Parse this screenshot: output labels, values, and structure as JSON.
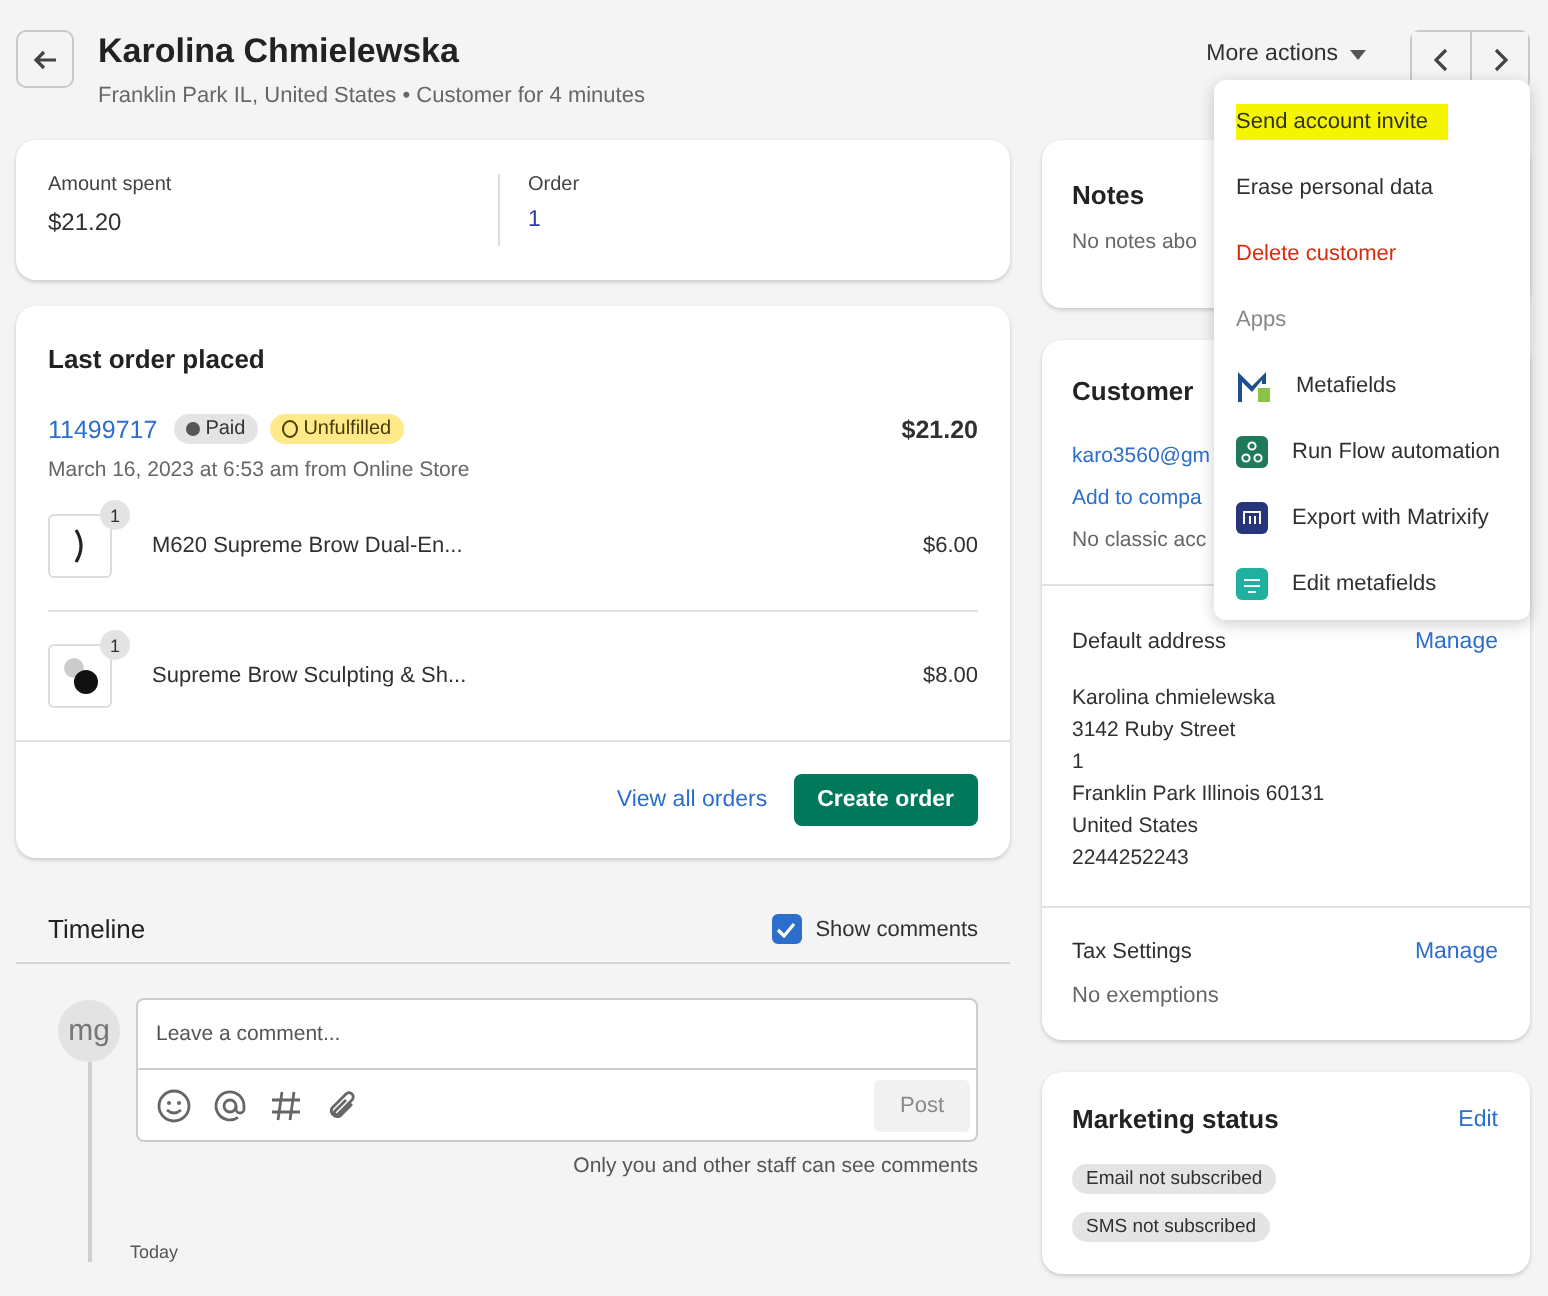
{
  "header": {
    "title": "Karolina Chmielewska",
    "subtitle": "Franklin Park IL, United States • Customer for 4 minutes",
    "more_actions": "More actions"
  },
  "stats": [
    {
      "label": "Amount spent",
      "value": "$21.20",
      "link": false
    },
    {
      "label": "Order",
      "value": "1",
      "link": true
    }
  ],
  "last_order": {
    "title": "Last order placed",
    "number": "11499717",
    "badges": [
      {
        "label": "Paid",
        "kind": "paid"
      },
      {
        "label": "Unfulfilled",
        "kind": "unfulfilled"
      }
    ],
    "total": "$21.20",
    "meta": "March 16, 2023 at 6:53 am from Online Store",
    "items": [
      {
        "quantity": "1",
        "name": "M620 Supreme Brow Dual-En...",
        "price": "$6.00",
        "kind": "picture"
      },
      {
        "quantity": "1",
        "name": "Supreme Brow Sculpting & Sh...",
        "price": "$8.00",
        "kind": "picture"
      }
    ],
    "view_all": "View all orders",
    "create": "Create order"
  },
  "timeline": {
    "title": "Timeline",
    "show_comments": {
      "label": "Show comments",
      "checked": true
    },
    "avatar": "mg",
    "placeholder": "Leave a comment...",
    "post": "Post",
    "note": "Only you and other staff can see comments",
    "today": "Today"
  },
  "notes": {
    "title": "Notes",
    "text": "No notes abo"
  },
  "customer": {
    "title": "Customer",
    "email": "karo3560@gm",
    "add_company": "Add to compa",
    "classic": "No classic acc",
    "address_title": "Default address",
    "address_manage": "Manage",
    "address": [
      "Karolina chmielewska",
      "3142 Ruby Street",
      "1",
      "Franklin Park Illinois 60131",
      "United States",
      "2244252243"
    ],
    "tax_title": "Tax Settings",
    "tax_manage": "Manage",
    "tax_text": "No exemptions"
  },
  "marketing": {
    "title": "Marketing status",
    "edit": "Edit",
    "badges": [
      "Email not subscribed",
      "SMS not subscribed"
    ]
  },
  "menu": {
    "items": [
      {
        "label": "Send account invite",
        "kind": "action",
        "highlighted": true
      },
      {
        "label": "Erase personal data",
        "kind": "action",
        "highlighted": false
      },
      {
        "label": "Delete customer",
        "kind": "danger",
        "highlighted": false
      },
      {
        "label": "Apps",
        "kind": "section",
        "highlighted": false
      },
      {
        "label": "Metafields",
        "kind": "app",
        "highlighted": false
      },
      {
        "label": "Run Flow automation",
        "kind": "app",
        "highlighted": false
      },
      {
        "label": "Export with Matrixify",
        "kind": "app",
        "highlighted": false
      },
      {
        "label": "Edit metafields",
        "kind": "app",
        "highlighted": false
      }
    ]
  }
}
